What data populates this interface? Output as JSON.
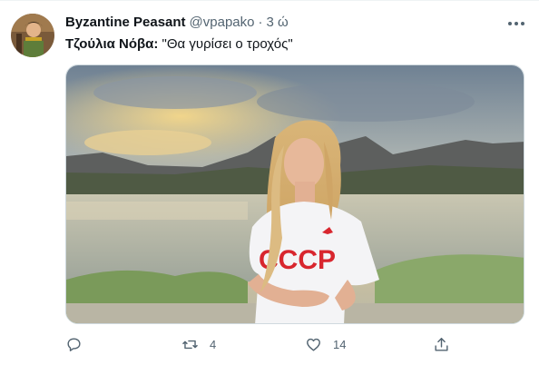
{
  "tweet": {
    "display_name": "Byzantine Peasant",
    "handle": "@vpapako",
    "separator": "·",
    "time": "3 ώ",
    "speaker": "Τζούλια Νόβα:",
    "quote": " \"Θα γυρίσει ο τροχός\"",
    "media": {
      "description_icon": "photo-woman-lake",
      "shirt_text": "CCCP"
    }
  },
  "actions": {
    "reply_icon": "reply-icon",
    "retweet_icon": "retweet-icon",
    "retweet_count": "4",
    "like_icon": "heart-icon",
    "like_count": "14",
    "share_icon": "share-icon"
  },
  "colors": {
    "secondary_text": "#536471",
    "border": "#cfd9de",
    "shirt_red": "#d8262e"
  }
}
